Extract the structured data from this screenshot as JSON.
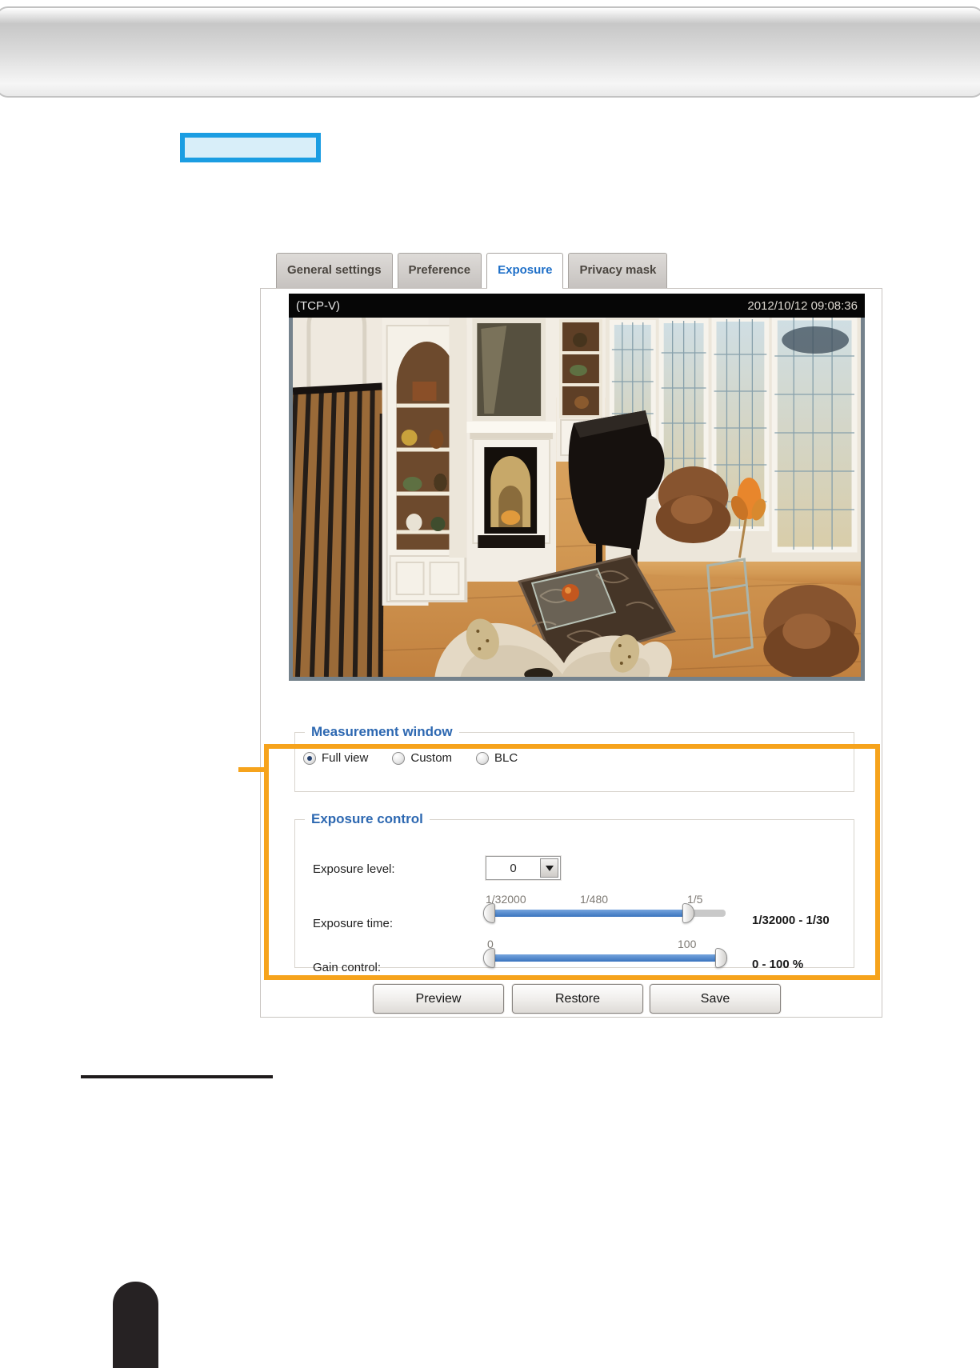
{
  "tabs": [
    {
      "label": "General settings",
      "active": false
    },
    {
      "label": "Preference",
      "active": false
    },
    {
      "label": "Exposure",
      "active": true
    },
    {
      "label": "Privacy mask",
      "active": false
    }
  ],
  "video": {
    "stream_label": "(TCP-V)",
    "timestamp": "2012/10/12 09:08:36"
  },
  "measurement_window": {
    "legend": "Measurement window",
    "options": [
      {
        "label": "Full view",
        "selected": true
      },
      {
        "label": "Custom",
        "selected": false
      },
      {
        "label": "BLC",
        "selected": false
      }
    ]
  },
  "exposure_control": {
    "legend": "Exposure control",
    "exposure_level": {
      "label": "Exposure level:",
      "value": "0"
    },
    "exposure_time": {
      "label": "Exposure time:",
      "scale_labels": [
        "1/32000",
        "1/480",
        "1/5"
      ],
      "value": "1/32000 - 1/30"
    },
    "gain_control": {
      "label": "Gain control:",
      "scale_labels": [
        "0",
        "100"
      ],
      "value": "0 - 100 %"
    }
  },
  "buttons": {
    "preview": "Preview",
    "restore": "Restore",
    "save": "Save"
  },
  "colors": {
    "callout_orange": "#f6a31c",
    "highlight_cyan_border": "#1b9de2",
    "highlight_cyan_fill": "#d8eef9",
    "legend_blue": "#2d68b1",
    "active_tab_blue": "#1e6fc8",
    "slider_blue": "#3a74be",
    "video_frame_gray": "#75828c"
  }
}
